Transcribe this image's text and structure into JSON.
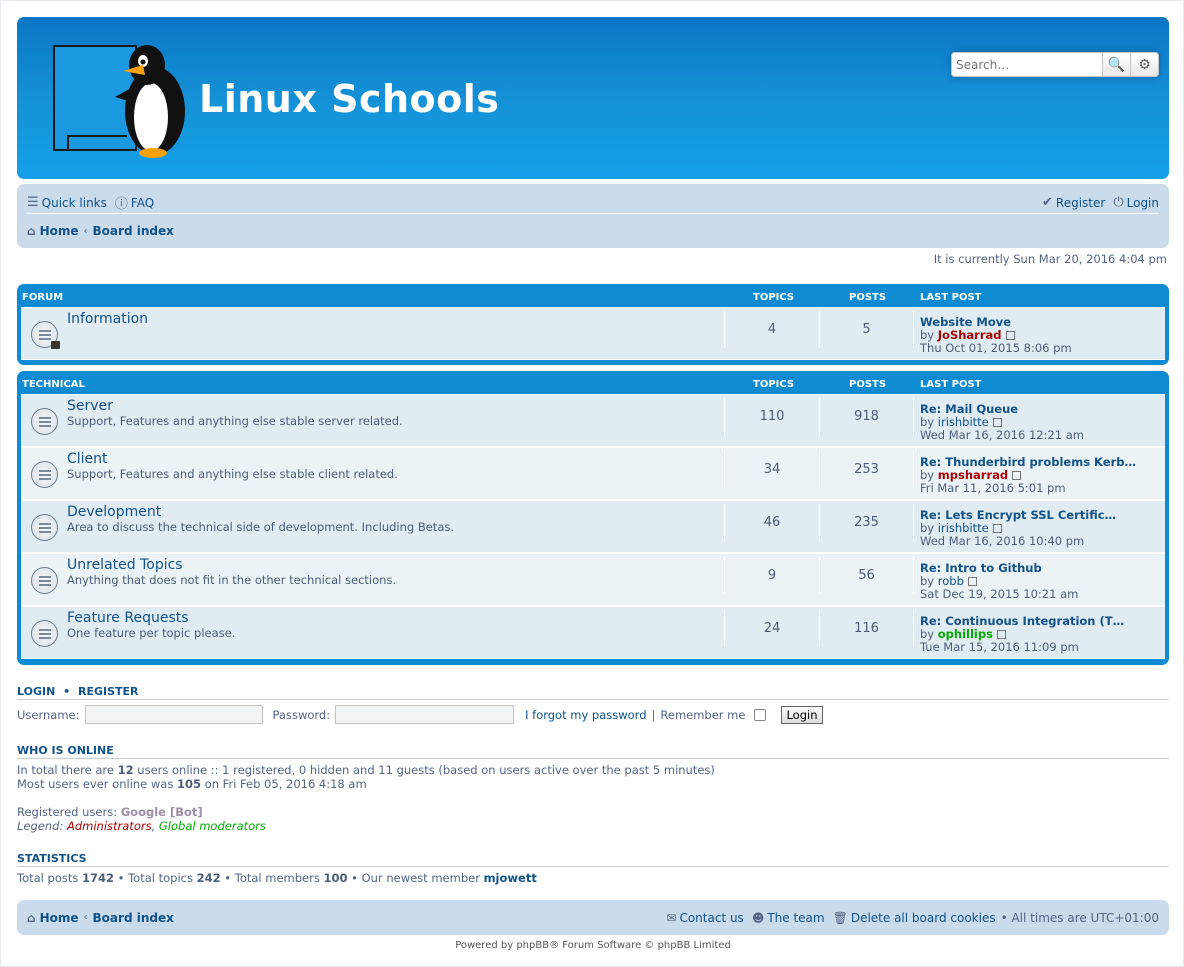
{
  "header": {
    "site_title": "Linux Schools",
    "search_placeholder": "Search…",
    "search_icon": "magnifier-icon",
    "advanced_search_icon": "gear-icon"
  },
  "navbar": {
    "quick_links": "Quick links",
    "faq": "FAQ",
    "register": "Register",
    "login": "Login",
    "breadcrumb": [
      "Home",
      "Board index"
    ]
  },
  "current_time": "It is currently Sun Mar 20, 2016 4:04 pm",
  "categories": [
    {
      "name": "Forum",
      "columns": [
        "Topics",
        "Posts",
        "Last post"
      ],
      "forums": [
        {
          "title": "Information",
          "desc": "",
          "topics": "4",
          "posts": "5",
          "last_title": "Website Move",
          "by": "by",
          "last_user": "JoSharrad",
          "last_date": "Thu Oct 01, 2015 8:06 pm",
          "locked": true
        }
      ]
    },
    {
      "name": "Technical",
      "columns": [
        "Topics",
        "Posts",
        "Last post"
      ],
      "forums": [
        {
          "title": "Server",
          "desc": "Support, Features and anything else stable server related.",
          "topics": "110",
          "posts": "918",
          "last_title": "Re: Mail Queue",
          "by": "by",
          "last_user": "irishbitte",
          "last_date": "Wed Mar 16, 2016 12:21 am"
        },
        {
          "title": "Client",
          "desc": "Support, Features and anything else stable client related.",
          "topics": "34",
          "posts": "253",
          "last_title": "Re: Thunderbird problems Kerb…",
          "by": "by",
          "last_user": "mpsharrad",
          "last_date": "Fri Mar 11, 2016 5:01 pm"
        },
        {
          "title": "Development",
          "desc": "Area to discuss the technical side of development. Including Betas.",
          "topics": "46",
          "posts": "235",
          "last_title": "Re: Lets Encrypt SSL Certific…",
          "by": "by",
          "last_user": "irishbitte",
          "last_date": "Wed Mar 16, 2016 10:40 pm"
        },
        {
          "title": "Unrelated Topics",
          "desc": "Anything that does not fit in the other technical sections.",
          "topics": "9",
          "posts": "56",
          "last_title": "Re: Intro to Github",
          "by": "by",
          "last_user": "robb",
          "last_date": "Sat Dec 19, 2015 10:21 am"
        },
        {
          "title": "Feature Requests",
          "desc": "One feature per topic please.",
          "topics": "24",
          "posts": "116",
          "last_title": "Re: Continuous Integration (T…",
          "by": "by",
          "last_user": "ophillips",
          "last_date": "Tue Mar 15, 2016 11:09 pm"
        }
      ]
    }
  ],
  "login_box": {
    "title_login": "Login",
    "title_sep": "•",
    "title_register": "Register",
    "username_label": "Username:",
    "password_label": "Password:",
    "forgot": "I forgot my password",
    "separator": "|",
    "remember": "Remember me",
    "button": "Login"
  },
  "online": {
    "title": "Who is online",
    "line1_a": "In total there are ",
    "line1_n": "12",
    "line1_b": " users online :: 1 registered, 0 hidden and 11 guests (based on users active over the past 5 minutes)",
    "line2_a": "Most users ever online was ",
    "line2_n": "105",
    "line2_b": " on Fri Feb 05, 2016 4:18 am",
    "registered_label": "Registered users: ",
    "registered_user": "Google [Bot]",
    "legend_label": "Legend: ",
    "legend_admin": "Administrators",
    "legend_comma": ", ",
    "legend_mod": "Global moderators"
  },
  "statistics": {
    "title": "Statistics",
    "posts_label": "Total posts ",
    "posts": "1742",
    "topics_label": " • Total topics ",
    "topics": "242",
    "members_label": " • Total members ",
    "members": "100",
    "newest_label": " • Our newest member ",
    "newest": "mjowett"
  },
  "footer": {
    "breadcrumb": [
      "Home",
      "Board index"
    ],
    "contact": "Contact us",
    "team": "The team",
    "delete_cookies": "Delete all board cookies",
    "timezone": "• All times are UTC+01:00",
    "powered": "Powered by phpBB® Forum Software © phpBB Limited"
  },
  "colors": {
    "header_blue": "#1593d8",
    "category_blue": "#0f8bd4",
    "admin_red": "#aa0000",
    "mod_green": "#00aa00",
    "link_blue": "#105289"
  }
}
